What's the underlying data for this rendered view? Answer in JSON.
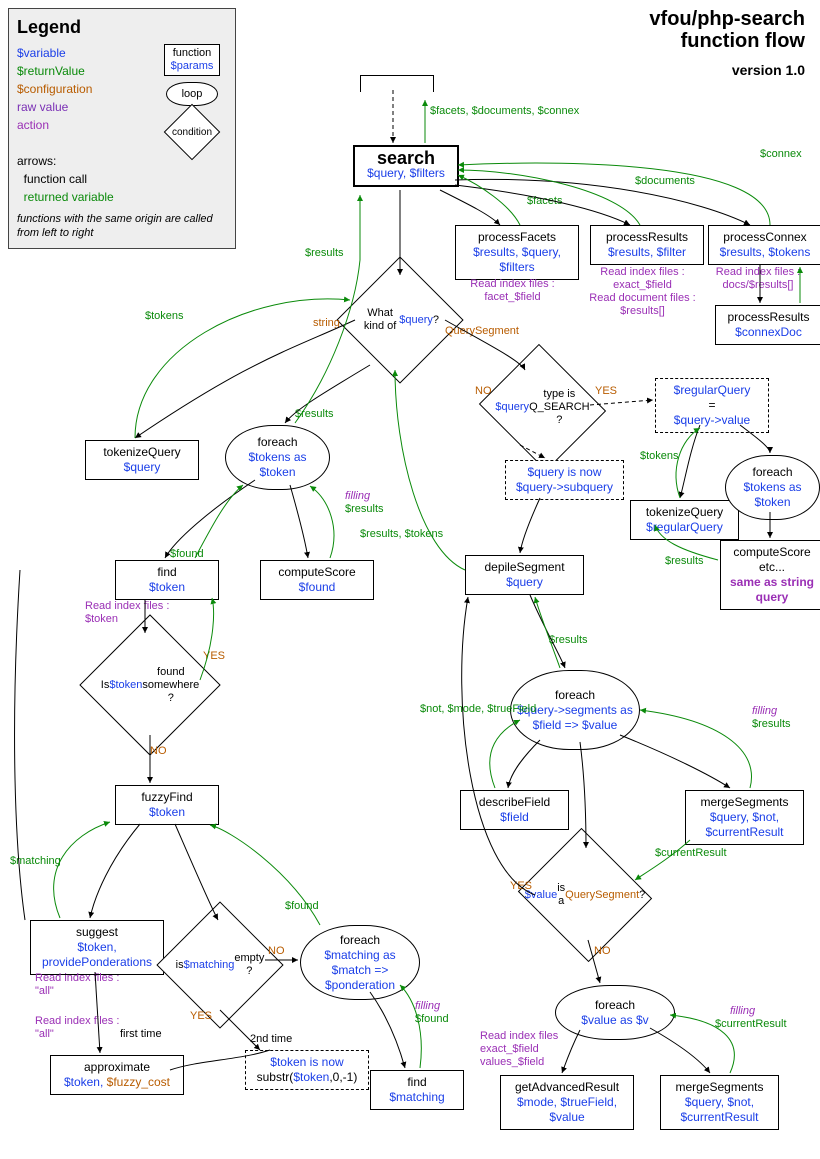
{
  "title": {
    "line1": "vfou/php-search",
    "line2": "function flow",
    "version": "version 1.0"
  },
  "legend": {
    "heading": "Legend",
    "variable": "$variable",
    "returnValue": "$returnValue",
    "configuration": "$configuration",
    "rawValue": "raw value",
    "action": "action",
    "arrows": "arrows:",
    "arrowFn": "function call",
    "arrowRet": "returned variable",
    "note": "functions with the same origin are called from left to right",
    "boxFn": "function",
    "boxParams": "$params",
    "loop": "loop",
    "cond": "condition"
  },
  "nodes": {
    "search": {
      "fn": "search",
      "pr": "$query, $filters"
    },
    "processFacets": {
      "fn": "processFacets",
      "pr": "$results, $query, $filters"
    },
    "processResults": {
      "fn": "processResults",
      "pr": "$results, $filter"
    },
    "processConnex": {
      "fn": "processConnex",
      "pr": "$results, $tokens"
    },
    "processResults2": {
      "fn": "processResults",
      "pr": "$connexDoc"
    },
    "tokenizeQuery": {
      "fn": "tokenizeQuery",
      "pr": "$query"
    },
    "foreachTokens": {
      "text": "foreach",
      "v": "$tokens as $token"
    },
    "find": {
      "fn": "find",
      "pr": "$token"
    },
    "computeScore": {
      "fn": "computeScore",
      "pr": "$found"
    },
    "fuzzyFind": {
      "fn": "fuzzyFind",
      "pr": "$token"
    },
    "suggest": {
      "fn": "suggest",
      "pr": "$token, providePonderations"
    },
    "approximate": {
      "fn": "approximate",
      "pr": "$token, $fuzzy_cost"
    },
    "foreachMatching": {
      "text": "foreach",
      "v": "$matching as $match => $ponderation"
    },
    "find2": {
      "fn": "find",
      "pr": "$matching"
    },
    "tokenIsNow": {
      "v": "$token is now",
      "e": "substr($token,0,-1)"
    },
    "depileSegment": {
      "fn": "depileSegment",
      "pr": "$query"
    },
    "foreachSegments": {
      "text": "foreach",
      "v": "$query->segments as $field => $value"
    },
    "describeField": {
      "fn": "describeField",
      "pr": "$field"
    },
    "mergeSegments": {
      "fn": "mergeSegments",
      "pr": "$query, $not, $currentResult"
    },
    "foreachValue": {
      "text": "foreach",
      "v": "$value as $v"
    },
    "getAdvancedResult": {
      "fn": "getAdvancedResult",
      "pr": "$mode, $trueField, $value"
    },
    "mergeSegments2": {
      "fn": "mergeSegments",
      "pr": "$query, $not, $currentResult"
    },
    "regularQuery": {
      "v1": "$regularQuery",
      "eq": "=",
      "v2": "$query->value"
    },
    "queryIsNow": {
      "v": "$query is now",
      "e": "$query->subquery"
    },
    "tokenizeQuery2": {
      "fn": "tokenizeQuery",
      "pr": "$regularQuery"
    },
    "foreachTokens2": {
      "text": "foreach",
      "v": "$tokens as $token"
    },
    "computeScore2": {
      "fn": "computeScore etc...",
      "pr": "same as string query"
    }
  },
  "labels": {
    "results": "$results",
    "tokens": "$tokens",
    "facets": "$facets",
    "documents": "$documents",
    "connex": "$connex",
    "facetsDocsConnex": "$facets, $documents, $connex",
    "string": "string",
    "QuerySegment": "QuerySegment",
    "NO": "NO",
    "YES": "YES",
    "filling": "filling",
    "found": "$found",
    "matching": "$matching",
    "resultsTokens": "$results, $tokens",
    "notModeTrueField": "$not, $mode, $trueField",
    "currentResult": "$currentResult",
    "firstTime": "first time",
    "secondTime": "2nd time",
    "same": "same as string query"
  },
  "conds": {
    "whatKind": "What kind of $query ?",
    "qsearch": "$query type is Q_SEARCH ?",
    "tokenFound": "Is $token found somewhere ?",
    "matchingEmpty": "is $matching empty ?",
    "valueIsQS": "$value is a QuerySegment ?"
  },
  "reads": {
    "facet": "Read index files : facet_$field",
    "exact": "Read index files : exact_$field\nRead document files : $results[]",
    "docs": "Read index files : docs/$results[]",
    "token": "Read index files : $token",
    "all": "Read index files : \"all\"",
    "exactValues": "Read index files exact_$field values_$field"
  }
}
